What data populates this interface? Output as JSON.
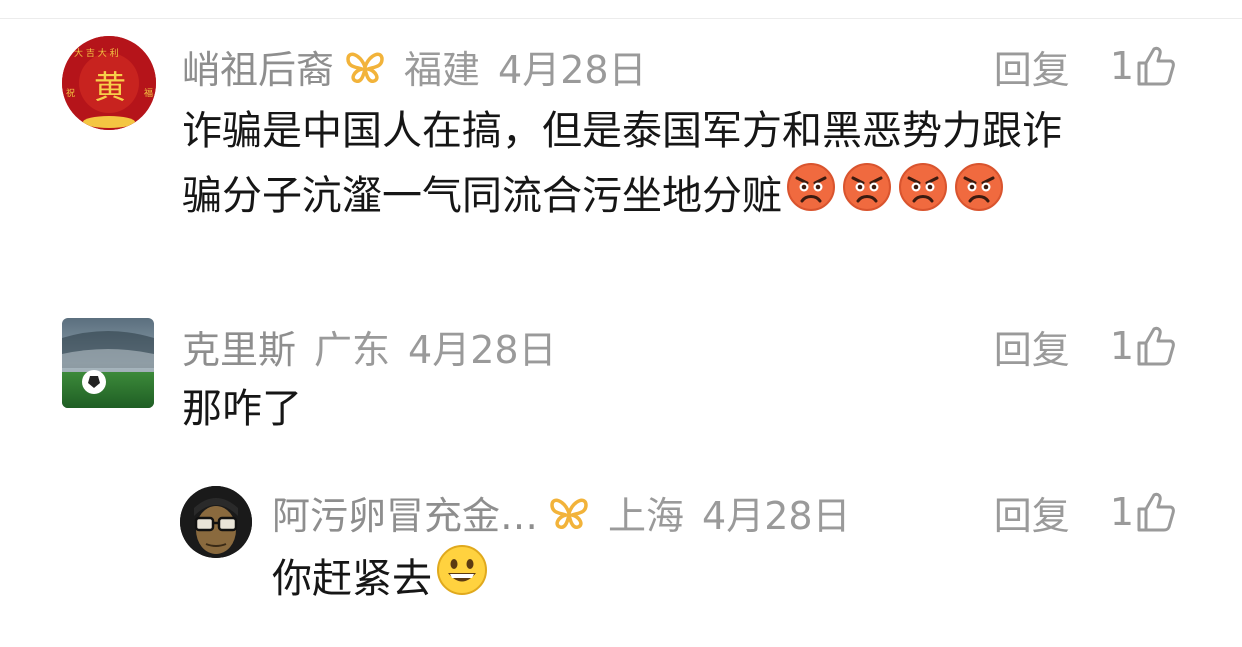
{
  "comments": [
    {
      "username": "峭祖后裔",
      "location": "福建",
      "date": "4月28日",
      "verified_icon": "butterfly-vip-icon",
      "avatar_text": "黄",
      "text_line1": "诈骗是中国人在搞，但是泰国军方和黑恶势力跟诈",
      "text_line2": "骗分子沆瀣一气同流合污坐地分赃",
      "emojis": [
        "angry-face-icon",
        "angry-face-icon",
        "angry-face-icon",
        "angry-face-icon"
      ],
      "reply_label": "回复",
      "like_count": "1"
    },
    {
      "username": "克里斯",
      "location": "广东",
      "date": "4月28日",
      "text_line1": "那咋了",
      "reply_label": "回复",
      "like_count": "1"
    },
    {
      "username": "阿污卵冒充金…",
      "location": "上海",
      "date": "4月28日",
      "verified_icon": "butterfly-vip-icon",
      "text_line1": "你赶紧去",
      "emojis": [
        "grinning-face-icon"
      ],
      "reply_label": "回复",
      "like_count": "1"
    }
  ],
  "colors": {
    "meta_text": "#9a9a9a",
    "body_text": "#161616",
    "vip_gold": "#f2b33a",
    "avatar_red": "#b5141a"
  }
}
